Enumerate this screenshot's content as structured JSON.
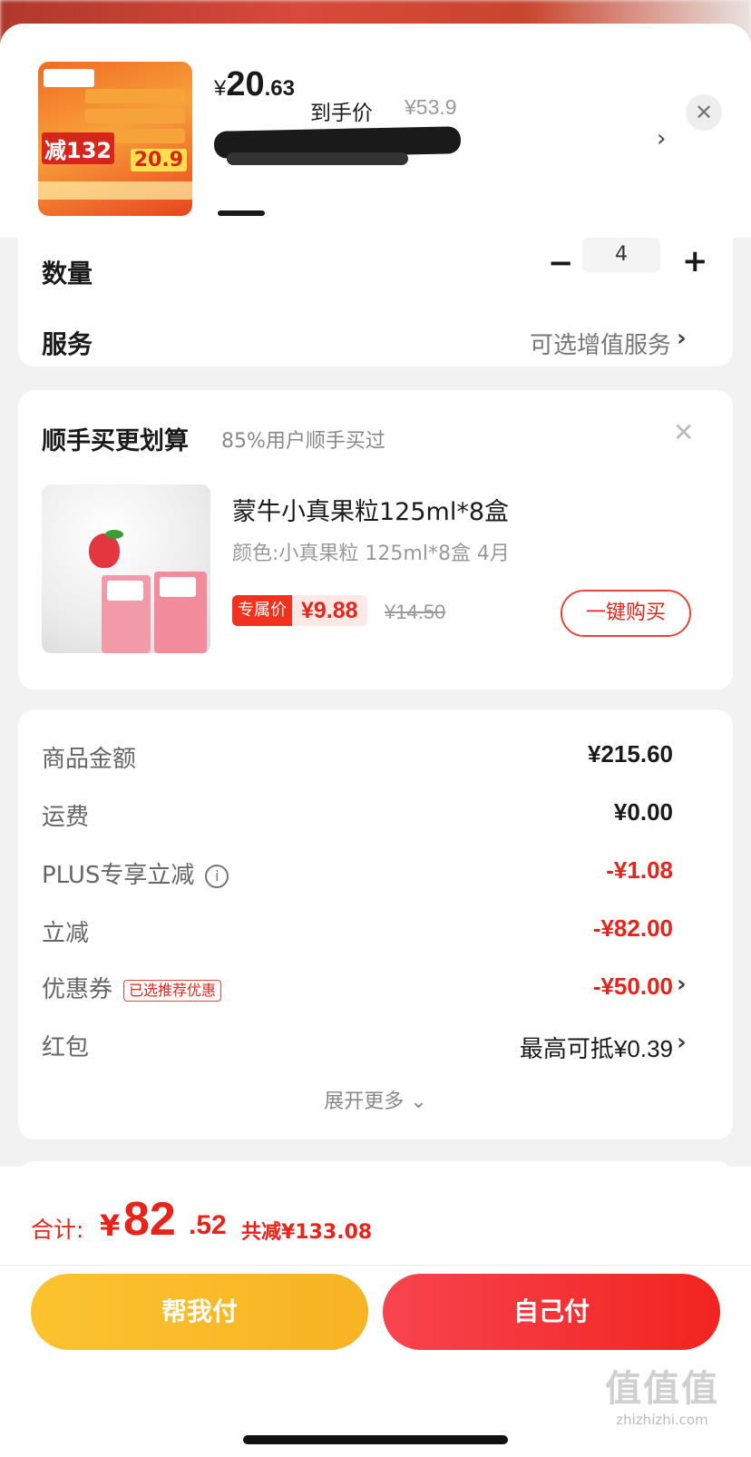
{
  "header": {
    "price_yen": "¥",
    "price_int": "20",
    "price_dec": ".63",
    "price_label": "到手价",
    "original_price": "¥53.9",
    "close_symbol": "✕",
    "chevron": "›",
    "thumb": {
      "cut_text": "减132",
      "promo_price": "20.9"
    }
  },
  "quantity": {
    "label": "数量",
    "minus": "−",
    "value": "4",
    "plus": "+"
  },
  "service": {
    "label": "服务",
    "value": "可选增值服务",
    "chevron": "›"
  },
  "addon": {
    "title": "顺手买更划算",
    "subtitle": "85%用户顺手买过",
    "close_symbol": "✕",
    "product": {
      "name": "蒙牛小真果粒125ml*8盒",
      "spec": "颜色:小真果粒 125ml*8盒 4月",
      "tag": "专属价",
      "price": "¥9.88",
      "old_price": "¥14.50",
      "buy_label": "一键购买"
    }
  },
  "summary": {
    "rows": [
      {
        "label": "商品金额",
        "value": "¥215.60"
      },
      {
        "label": "运费",
        "value": "¥0.00"
      },
      {
        "label": "PLUS专享立减",
        "value": "-¥1.08"
      },
      {
        "label": "立减",
        "value": "-¥82.00"
      },
      {
        "label": "优惠券",
        "tag": "已选推荐优惠",
        "value": "-¥50.00"
      },
      {
        "label": "红包",
        "value": "最高可抵¥0.39"
      }
    ],
    "info_icon": "i",
    "chevron": "›",
    "expand_label": "展开更多 ⌄"
  },
  "footer": {
    "total_label": "合计:",
    "total_yen": "¥",
    "total_int": "82",
    "total_dec": ".52",
    "saved": "共减¥133.08",
    "help_pay": "帮我付",
    "self_pay": "自己付"
  },
  "watermark": {
    "main": "值值值",
    "url": "zhizhizhi.com"
  },
  "colors": {
    "accent_red": "#e8231a",
    "pay_yellow": "#fcc32f",
    "pay_red": "#f1241f"
  }
}
